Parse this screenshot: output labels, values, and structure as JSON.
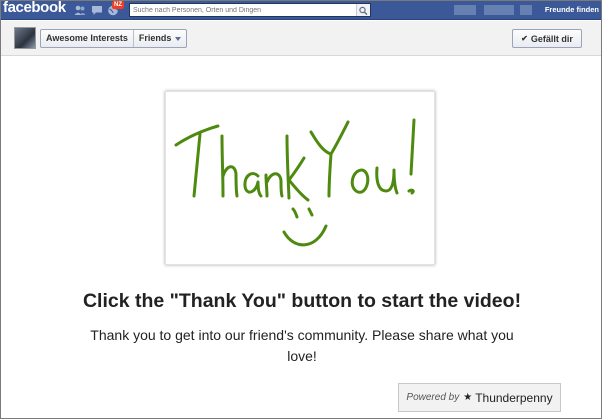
{
  "topbar": {
    "logo": "facebook",
    "badge_count": "NZ",
    "search_placeholder": "Suche nach Personen, Orten und Dingen",
    "friends_link": "Freunde finden"
  },
  "page": {
    "tab_app_label": "Awesome Interests",
    "tab_friends_label": "Friends",
    "like_label": "Gefällt dir"
  },
  "content": {
    "image_text": "Thank You!",
    "headline": "Click the \"Thank You\" button to start the video!",
    "subtext": "Thank you to get into our friend's community. Please share what you love!",
    "powered_by": "Powered by",
    "powered_brand": "Thunderpenny"
  },
  "colors": {
    "facebook_blue": "#3b5998",
    "handwriting_green": "#4f8a10"
  }
}
